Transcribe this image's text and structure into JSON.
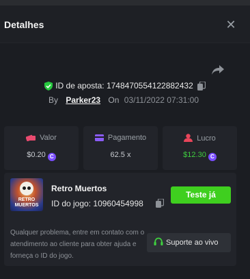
{
  "header": {
    "title": "Detalhes"
  },
  "bet": {
    "id_label": "ID de aposta:",
    "id_value": "1748470554122882432",
    "by_label": "By",
    "user": "Parker23",
    "on_label": "On",
    "datetime": "03/11/2022 07:31:00"
  },
  "stats": [
    {
      "label": "Valor",
      "value": "$0.20",
      "icon": "money-icon",
      "icon_color": "#e84a6f"
    },
    {
      "label": "Pagamento",
      "value": "62.5 x",
      "icon": "card-icon",
      "icon_color": "#8a5cf6"
    },
    {
      "label": "Lucro",
      "value": "$12.30",
      "icon": "user-icon",
      "icon_color": "#e8455a"
    }
  ],
  "game": {
    "name": "Retro Muertos",
    "thumb_title_1": "RETRO",
    "thumb_title_2": "MUERTOS",
    "id_label": "ID do jogo:",
    "id_value": "10960454998",
    "play_label": "Teste já"
  },
  "help_text": "Qualquer problema, entre em contato com o atendimento ao cliente para obter ajuda e forneça o ID do jogo.",
  "support_label": "Suporte ao vivo",
  "colors": {
    "accent_green": "#3fcf1f",
    "coin": "#7a4dff",
    "background": "#1b1d22"
  },
  "coin_symbol": "C"
}
